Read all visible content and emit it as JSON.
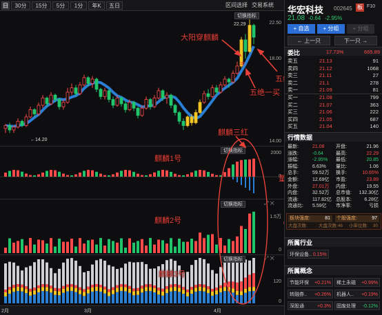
{
  "toolbar": {
    "periods": [
      "日",
      "30分",
      "15分",
      "5分",
      "1分",
      "年K",
      "五日"
    ],
    "selected": "日",
    "range_select": "区间选择",
    "trade_system": "交易系统"
  },
  "main_chart": {
    "switch_label": "切换指标",
    "y_ticks": [
      "22.50",
      "18.00",
      "14.00"
    ],
    "high_label": "22.29",
    "low_label": "←14.20",
    "signal_label": "冲",
    "candles": [
      [
        14.8,
        15.0,
        14.5,
        15.1
      ],
      [
        15.0,
        14.7,
        14.5,
        15.2
      ],
      [
        14.7,
        14.9,
        14.5,
        15.0
      ],
      [
        14.9,
        15.3,
        14.8,
        15.5
      ],
      [
        15.3,
        15.0,
        14.9,
        15.4
      ],
      [
        15.0,
        15.6,
        14.9,
        15.8
      ],
      [
        15.6,
        16.1,
        15.5,
        16.3
      ],
      [
        16.1,
        15.8,
        15.6,
        16.2
      ],
      [
        15.8,
        16.4,
        15.7,
        16.6
      ],
      [
        16.4,
        16.9,
        16.2,
        17.1
      ],
      [
        16.9,
        16.5,
        16.3,
        17.0
      ],
      [
        16.5,
        17.1,
        16.4,
        17.3
      ],
      [
        17.1,
        16.8,
        16.6,
        17.2
      ],
      [
        16.8,
        16.3,
        16.1,
        16.9
      ],
      [
        16.3,
        16.6,
        16.1,
        16.8
      ],
      [
        16.6,
        17.3,
        16.5,
        17.6
      ],
      [
        17.3,
        17.6,
        17.1,
        17.9
      ],
      [
        17.6,
        17.2,
        17.0,
        17.8
      ],
      [
        17.2,
        17.8,
        17.1,
        18.0
      ],
      [
        17.8,
        18.3,
        17.7,
        18.5
      ],
      [
        18.3,
        17.9,
        17.7,
        18.4
      ],
      [
        17.9,
        18.2,
        17.6,
        18.4
      ],
      [
        18.2,
        17.5,
        17.3,
        18.3
      ],
      [
        17.5,
        17.0,
        16.8,
        17.6
      ],
      [
        17.0,
        17.4,
        16.8,
        17.6
      ],
      [
        17.4,
        16.8,
        16.6,
        17.5
      ],
      [
        16.8,
        16.4,
        16.2,
        17.0
      ],
      [
        16.4,
        16.9,
        16.3,
        17.1
      ],
      [
        16.9,
        16.5,
        16.3,
        17.0
      ],
      [
        16.5,
        16.1,
        15.9,
        16.7
      ],
      [
        16.1,
        16.6,
        16.0,
        16.8
      ],
      [
        16.6,
        16.2,
        16.0,
        16.7
      ],
      [
        16.2,
        15.7,
        15.5,
        16.3
      ],
      [
        15.7,
        16.2,
        15.6,
        16.4
      ],
      [
        16.2,
        16.8,
        16.1,
        17.0
      ],
      [
        16.8,
        16.3,
        16.1,
        16.9
      ],
      [
        16.3,
        16.9,
        16.2,
        17.1
      ],
      [
        16.9,
        17.4,
        16.8,
        17.6
      ],
      [
        17.4,
        16.9,
        16.7,
        17.5
      ],
      [
        16.9,
        17.1,
        16.5,
        17.3
      ],
      [
        17.1,
        16.4,
        16.2,
        17.2
      ],
      [
        16.4,
        15.9,
        15.7,
        16.5
      ],
      [
        15.9,
        15.3,
        15.1,
        16.0
      ],
      [
        15.3,
        15.0,
        14.7,
        15.5
      ],
      [
        15.0,
        15.6,
        14.9,
        15.7
      ],
      [
        15.6,
        15.2,
        15.0,
        15.8
      ],
      [
        15.2,
        15.9,
        15.1,
        16.1
      ],
      [
        15.9,
        16.6,
        15.8,
        16.8
      ],
      [
        16.6,
        17.2,
        16.5,
        17.4
      ],
      [
        17.2,
        17.0,
        16.8,
        17.5
      ],
      [
        17.0,
        17.6,
        16.9,
        17.8
      ],
      [
        17.6,
        17.3,
        17.1,
        17.8
      ],
      [
        17.3,
        17.8,
        17.2,
        18.0
      ],
      [
        17.8,
        18.2,
        17.7,
        18.4
      ],
      [
        18.2,
        18.0,
        17.6,
        18.3
      ],
      [
        18.0,
        18.6,
        17.9,
        18.8
      ],
      [
        18.6,
        19.1,
        18.5,
        19.4
      ],
      [
        19.1,
        20.9,
        19.0,
        21.1
      ],
      [
        20.9,
        20.1,
        19.6,
        21.3
      ],
      [
        20.1,
        21.9,
        20.0,
        22.29
      ],
      [
        21.9,
        21.08,
        20.6,
        22.0
      ]
    ],
    "yellow_candles": [
      44,
      45,
      46,
      47,
      57,
      59
    ]
  },
  "annotations": {
    "a1": "大阳穿麒麟",
    "a2": "五绝二买",
    "a3": "五绝一买",
    "a4": "麒麟三红",
    "a5": "麒麟1号",
    "a6": "麒麟2号",
    "a7": "麒麟3号",
    "a8": "量化强度"
  },
  "panel1": {
    "switch_label": "切换指标",
    "y_ticks": [
      "2000",
      "0"
    ]
  },
  "panel2": {
    "switch_label": "切换指标",
    "y_ticks": [
      "1.5万",
      "0"
    ]
  },
  "panel3": {
    "switch_label": "切换指标",
    "y_ticks": [
      "120",
      "0"
    ]
  },
  "xaxis": {
    "labels": [
      "2月",
      "3月",
      "4月"
    ]
  },
  "stock": {
    "name": "华宏科技",
    "code": "002645",
    "price": "21.08",
    "change": "-0.64",
    "pct": "-2.95%",
    "tag": "板",
    "f10": "F10",
    "add_self": "+ 自选",
    "add_group": "+ 分组",
    "add_group2": "+ 分组",
    "prev": "上一只",
    "next": "下一只"
  },
  "orderbook": {
    "title": "委比",
    "ratio": "17.73%",
    "ratio_val": "665.89",
    "asks": [
      [
        "卖五",
        "21.13",
        "91"
      ],
      [
        "卖四",
        "21.12",
        "1068"
      ],
      [
        "卖三",
        "21.11",
        "27"
      ],
      [
        "卖二",
        "21.1",
        "278"
      ],
      [
        "卖一",
        "21.09",
        "81"
      ]
    ],
    "bids": [
      [
        "买一",
        "21.08",
        "799"
      ],
      [
        "买二",
        "21.07",
        "363"
      ],
      [
        "买三",
        "21.06",
        "222"
      ],
      [
        "买四",
        "21.05",
        "687"
      ],
      [
        "买五",
        "21.04",
        "140"
      ]
    ]
  },
  "quote": {
    "title": "行情数据",
    "rows": [
      [
        "最新:",
        "21.08",
        "开盘:",
        "21.96"
      ],
      [
        "涨跌:",
        "-0.64",
        "最高:",
        "22.29"
      ],
      [
        "涨幅:",
        "-2.95%",
        "最低:",
        "20.85"
      ],
      [
        "振幅:",
        "6.63%",
        "量比:",
        "1.06"
      ],
      [
        "总手:",
        "59.52万",
        "换手:",
        "10.65%"
      ],
      [
        "金额:",
        "12.69亿",
        "市盈:",
        "23.89"
      ],
      [
        "外盘:",
        "27.01万",
        "内盘:",
        "19.55"
      ],
      [
        "内盘:",
        "32.52万",
        "总市值:",
        "132.30亿"
      ],
      [
        "流通:",
        "117.82亿",
        "总股本:",
        "6.28亿"
      ],
      [
        "流通比:",
        "5.59亿",
        "市净率:",
        "亏损"
      ]
    ]
  },
  "strength": {
    "sector_label": "板块强度:",
    "sector_val": "81",
    "stock_label": "个股强度:",
    "stock_val": "97",
    "big_label": "大盘次数:",
    "big_val": "大盘次数:46",
    "sec_label": "小单位数:",
    "sec_val": "30"
  },
  "industry": {
    "title": "所属行业",
    "item": "环保设备..",
    "pct": "0.15%"
  },
  "concepts": {
    "title": "所属概念",
    "items": [
      [
        "节能环保",
        "+0.21%"
      ],
      [
        "稀土永磁",
        "+0.99%"
      ],
      [
        "转融券..",
        "+0.26%"
      ],
      [
        "机器人..",
        "+0.19%"
      ],
      [
        "深股通",
        "+0.3%"
      ],
      [
        "固废处理",
        "-0.12%"
      ]
    ]
  }
}
